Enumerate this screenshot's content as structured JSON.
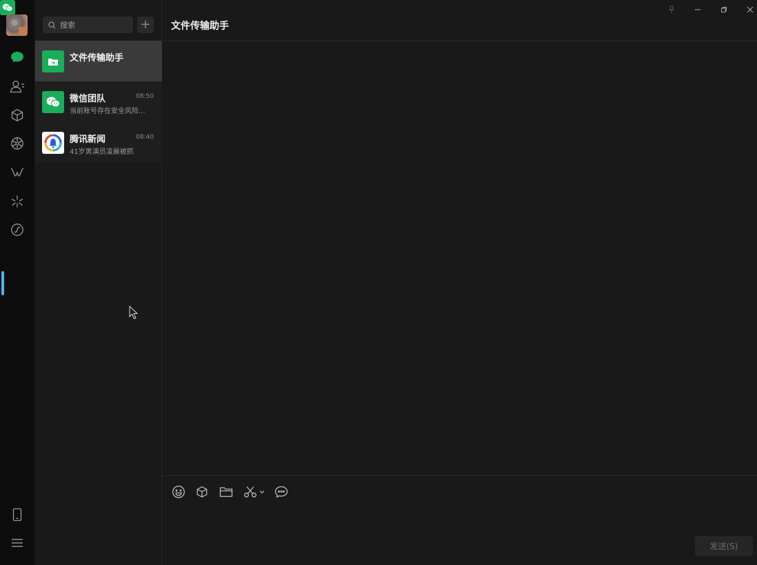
{
  "search": {
    "placeholder": "搜索",
    "add_icon": "plus-icon"
  },
  "chats": [
    {
      "name": "文件传输助手",
      "time": "",
      "preview": "",
      "icon": "file-transfer-icon",
      "color": "#1aad5a",
      "active": true
    },
    {
      "name": "微信团队",
      "time": "08:50",
      "preview": "当前账号存在安全风险...",
      "icon": "wechat-icon",
      "color": "#1aad5a",
      "active": false
    },
    {
      "name": "腾讯新闻",
      "time": "08:40",
      "preview": "41岁男演员凌晨被抓",
      "icon": "tencent-news-icon",
      "color": "#ffffff",
      "active": false
    }
  ],
  "conversation": {
    "title": "文件传输助手"
  },
  "composer": {
    "send_label": "发送(S)"
  },
  "colors": {
    "accent": "#1aad5a",
    "indicator": "#4fb3ff",
    "background": "#191919"
  }
}
